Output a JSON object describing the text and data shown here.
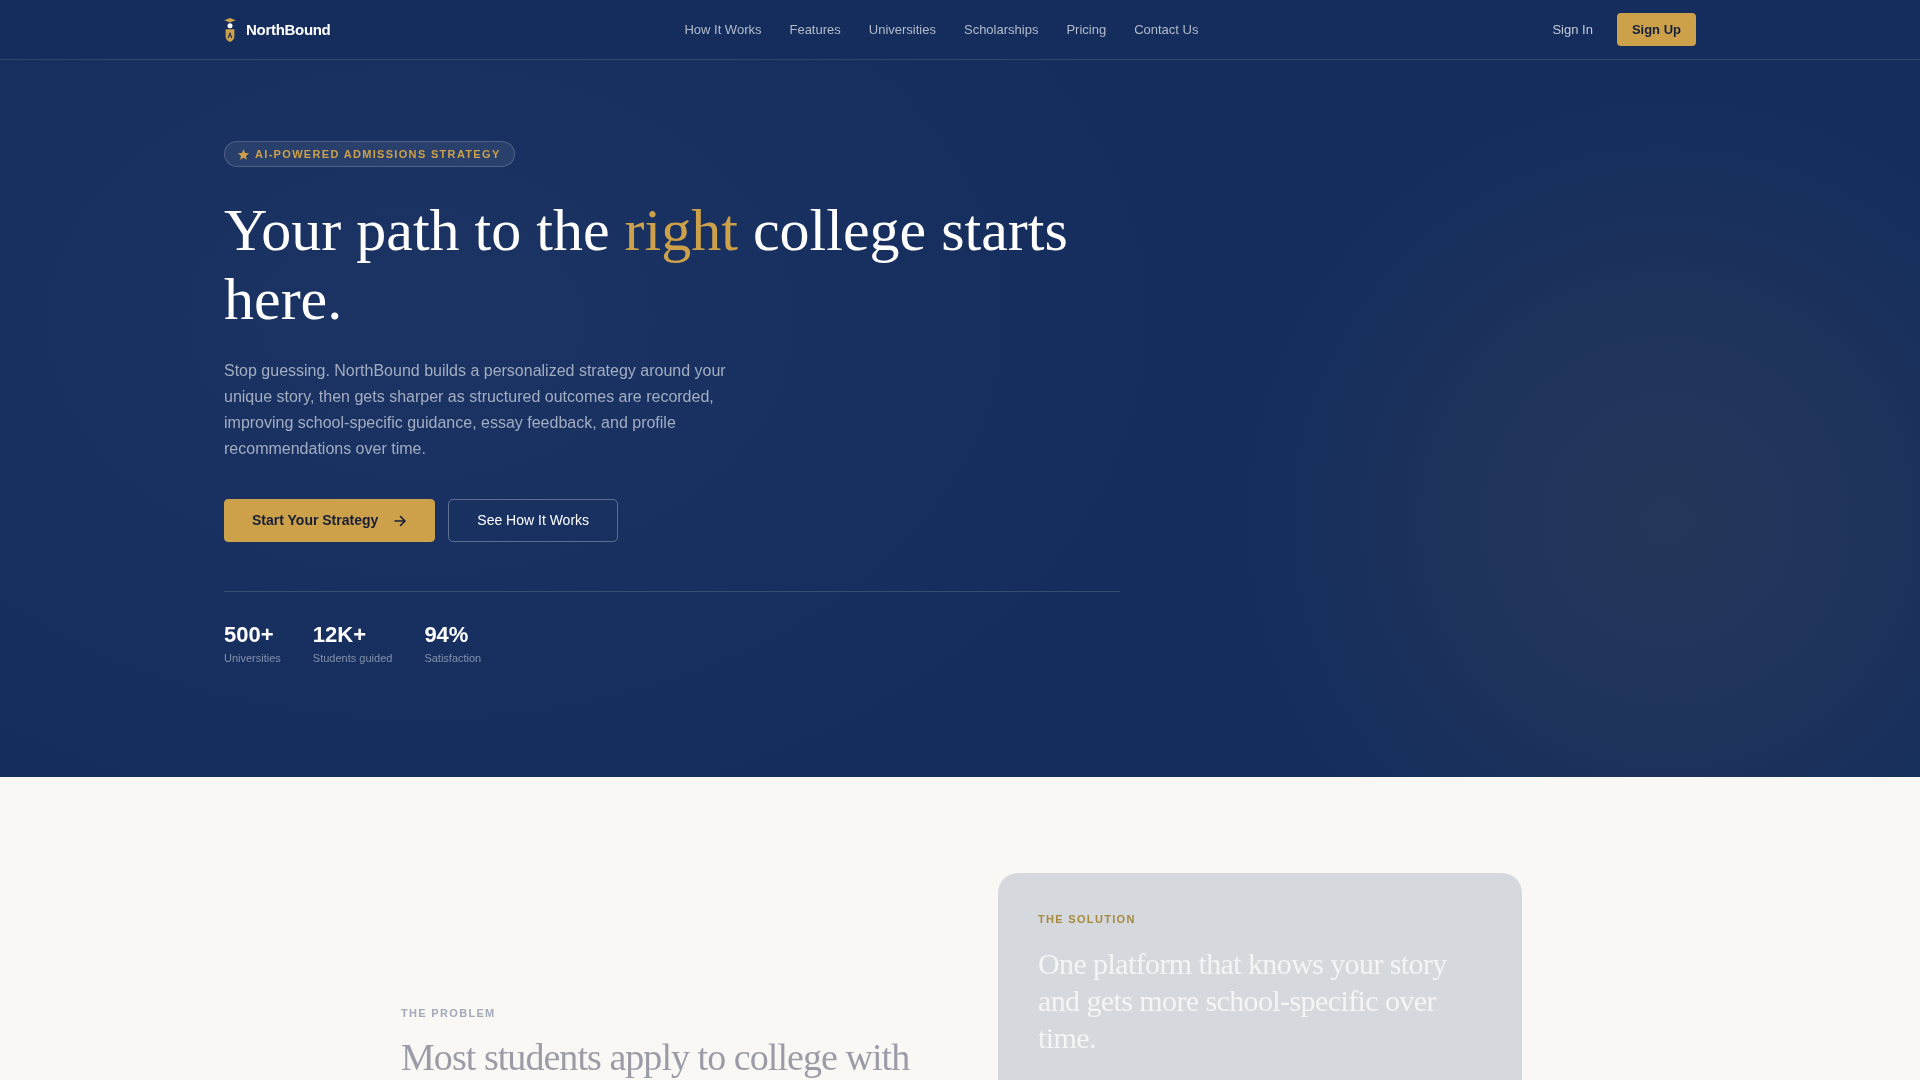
{
  "nav": {
    "brand": "NorthBound",
    "links": [
      "How It Works",
      "Features",
      "Universities",
      "Scholarships",
      "Pricing",
      "Contact Us"
    ],
    "sign_in": "Sign In",
    "sign_up": "Sign Up"
  },
  "hero": {
    "badge": "AI-POWERED ADMISSIONS STRATEGY",
    "headline": [
      {
        "text": "Your path to the ",
        "highlight": false
      },
      {
        "text": "right",
        "highlight": true
      },
      {
        "text": " college starts here.",
        "highlight": false
      }
    ],
    "description": "Stop guessing. NorthBound builds a personalized strategy around your unique story, then gets sharper as structured outcomes are recorded, improving school-specific guidance, essay feedback, and profile recommendations over time.",
    "buttons": [
      {
        "label": "Start Your Strategy",
        "kind": "primary"
      },
      {
        "label": "See How It Works",
        "kind": "outline"
      }
    ],
    "stats": [
      {
        "value": "500+",
        "label": "Universities"
      },
      {
        "value": "12K+",
        "label": "Students guided"
      },
      {
        "value": "94%",
        "label": "Satisfaction"
      }
    ]
  },
  "problem": {
    "eyebrow": "THE PROBLEM",
    "heading": "Most students apply to college with"
  },
  "solution": {
    "eyebrow": "THE SOLUTION",
    "heading": "One platform that knows your story and gets more school-specific over time."
  }
}
